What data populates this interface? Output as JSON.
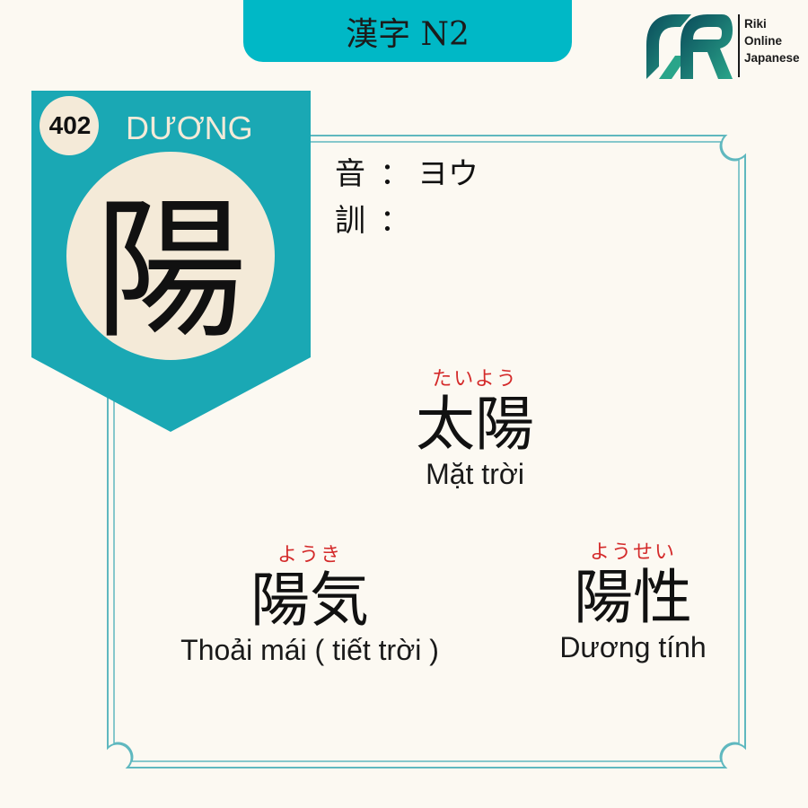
{
  "header": {
    "title": "漢字 N2"
  },
  "logo": {
    "line1": "Riki",
    "line2": "Online",
    "line3": "Japanese"
  },
  "kanji": {
    "number": "402",
    "han_viet": "DƯƠNG",
    "character": "陽"
  },
  "readings": {
    "on_label": "音",
    "on_value": "ヨウ",
    "kun_label": "訓",
    "kun_value": "",
    "colon": "："
  },
  "words": [
    {
      "furigana": "たいよう",
      "kanji": "太陽",
      "meaning": "Mặt trời"
    },
    {
      "furigana": "ようき",
      "kanji": "陽気",
      "meaning": "Thoải mái ( tiết trời )"
    },
    {
      "furigana": "ようせい",
      "kanji": "陽性",
      "meaning": "Dương tính"
    }
  ],
  "colors": {
    "teal": "#00b8c6",
    "badge_teal": "#1aa8b4",
    "cream": "#f4ead8",
    "furigana_red": "#d42a2a",
    "background": "#fcf9f2"
  }
}
